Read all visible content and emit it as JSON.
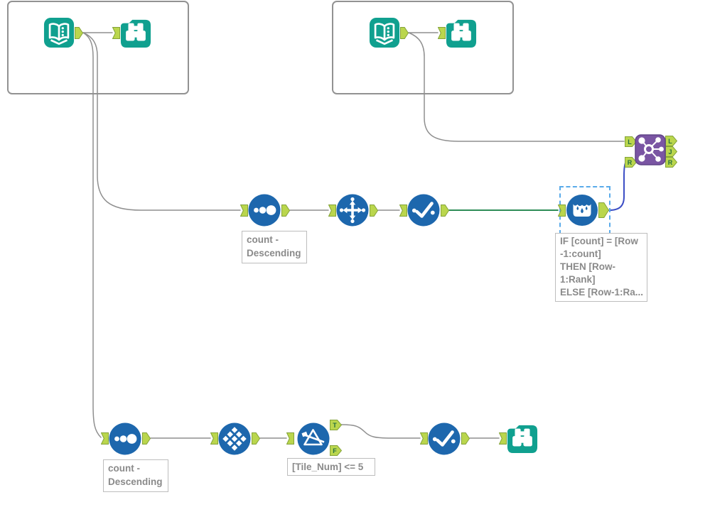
{
  "notes": {
    "sort_mid": {
      "lines": [
        "count -",
        "Descending"
      ]
    },
    "sort_bottom": {
      "lines": [
        "count -",
        "Descending"
      ]
    },
    "filter": {
      "text": "[Tile_Num] <= 5"
    },
    "multi_row_formula": {
      "lines": [
        "IF [count] = [Row",
        "-1:count]",
        "THEN [Row-",
        "1:Rank]",
        "ELSE [Row-1:Ra..."
      ]
    }
  },
  "anchors": {
    "join": {
      "inputs": [
        "L",
        "R"
      ],
      "outputs": [
        "L",
        "J",
        "R"
      ]
    },
    "filter": {
      "outputs": [
        "T",
        "F"
      ]
    }
  },
  "tools": [
    {
      "id": "input-data-1",
      "icon": "open-book-with-dots"
    },
    {
      "id": "browse-1",
      "icon": "binoculars"
    },
    {
      "id": "input-data-2",
      "icon": "open-book-with-dots"
    },
    {
      "id": "browse-2",
      "icon": "binoculars"
    },
    {
      "id": "join",
      "icon": "node-network"
    },
    {
      "id": "sort-1",
      "icon": "three-dots-ascending"
    },
    {
      "id": "arrange",
      "icon": "four-way-arrows"
    },
    {
      "id": "unique-1",
      "icon": "checkmark-with-dots"
    },
    {
      "id": "multi-row-formula",
      "icon": "crown-with-droplets"
    },
    {
      "id": "sort-2",
      "icon": "three-dots-ascending"
    },
    {
      "id": "tile",
      "icon": "diamond-mosaic"
    },
    {
      "id": "filter",
      "icon": "funnel-triangle"
    },
    {
      "id": "unique-2",
      "icon": "checkmark-with-dots"
    },
    {
      "id": "browse-3",
      "icon": "binoculars"
    }
  ],
  "colors": {
    "teal": "#10a08f",
    "tool_blue": "#1d67ad",
    "join_purple": "#7a55a3",
    "anchor_green": "#bad64d",
    "anchor_border": "#84a339",
    "anchor_letter": "#256e3e",
    "wire_gray": "#8f8f8f",
    "wire_green": "#0f7c3f",
    "wire_blue": "#3c4ec5",
    "selection_blue": "#5aabea",
    "note_text": "#8a8a8a",
    "note_border": "#bdbdbd",
    "container_border": "#929292",
    "canvas_bg": "#ffffff"
  }
}
